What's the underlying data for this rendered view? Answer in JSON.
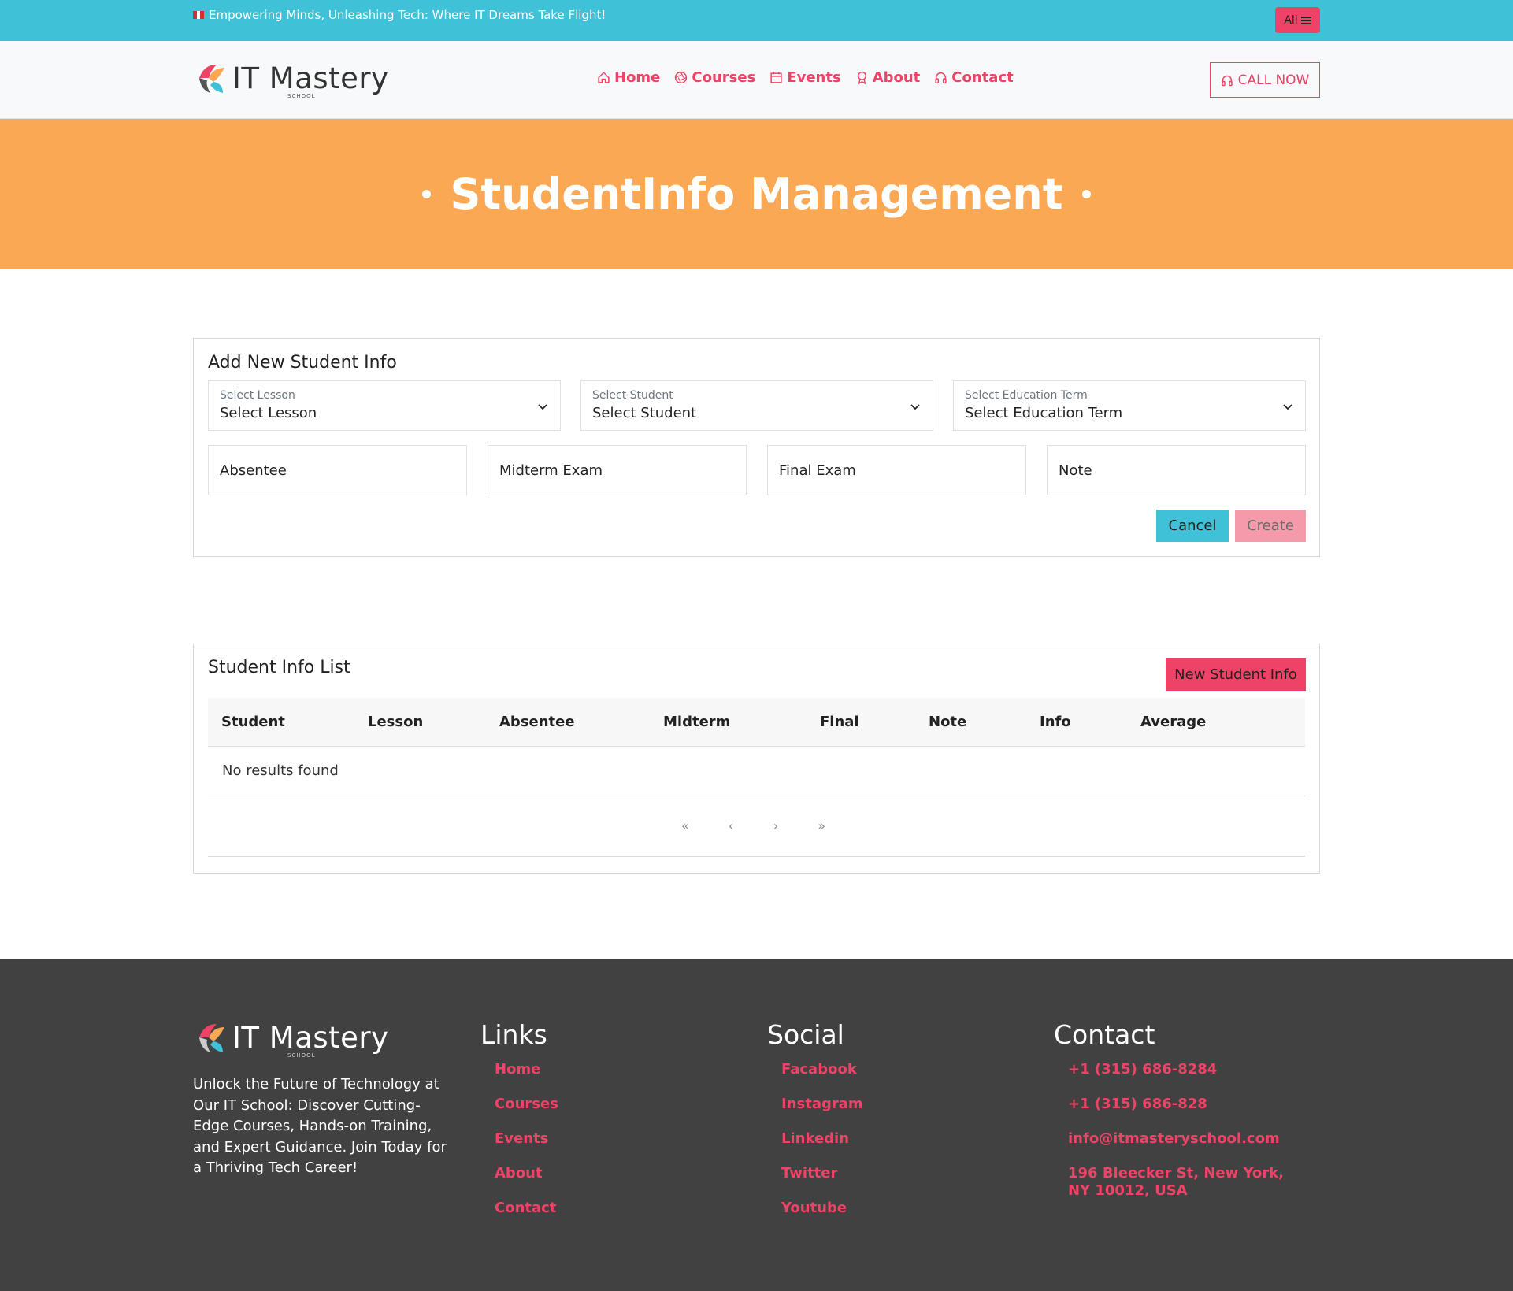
{
  "topbar": {
    "tagline": "Empowering Minds, Unleashing Tech: Where IT Dreams Take Flight!",
    "user_label": "Ali"
  },
  "brand": {
    "name": "IT Mastery",
    "sub": "SCHOOL"
  },
  "nav": {
    "items": [
      {
        "label": "Home",
        "icon": "home-icon"
      },
      {
        "label": "Courses",
        "icon": "aperture-icon"
      },
      {
        "label": "Events",
        "icon": "calendar-icon"
      },
      {
        "label": "About",
        "icon": "award-icon"
      },
      {
        "label": "Contact",
        "icon": "headphones-icon"
      }
    ],
    "call_label": "CALL NOW"
  },
  "hero": {
    "title": "StudentInfo Management"
  },
  "form": {
    "title": "Add New Student Info",
    "selects": [
      {
        "label": "Select Lesson",
        "value": "Select Lesson"
      },
      {
        "label": "Select Student",
        "value": "Select Student"
      },
      {
        "label": "Select Education Term",
        "value": "Select Education Term"
      }
    ],
    "inputs": [
      {
        "placeholder": "Absentee"
      },
      {
        "placeholder": "Midterm Exam"
      },
      {
        "placeholder": "Final Exam"
      },
      {
        "placeholder": "Note"
      }
    ],
    "cancel_label": "Cancel",
    "create_label": "Create"
  },
  "list": {
    "title": "Student Info List",
    "new_label": "New Student Info",
    "columns": [
      "Student",
      "Lesson",
      "Absentee",
      "Midterm",
      "Final",
      "Note",
      "Info",
      "Average"
    ],
    "empty_text": "No results found",
    "pager": [
      "«",
      "‹",
      "›",
      "»"
    ]
  },
  "footer": {
    "description": "Unlock the Future of Technology at Our IT School: Discover Cutting-Edge Courses, Hands-on Training, and Expert Guidance. Join Today for a Thriving Tech Career!",
    "links": {
      "title": "Links",
      "items": [
        "Home",
        "Courses",
        "Events",
        "About",
        "Contact"
      ]
    },
    "social": {
      "title": "Social",
      "items": [
        "Facabook",
        "Instagram",
        "Linkedin",
        "Twitter",
        "Youtube"
      ]
    },
    "contact": {
      "title": "Contact",
      "items": [
        "+1 (315) 686-8284",
        "+1 (315) 686-828",
        "info@itmasteryschool.com",
        "196 Bleecker St, New York, NY 10012, USA"
      ]
    }
  },
  "colors": {
    "cyan": "#3fc1d7",
    "pink": "#ee4266",
    "orange": "#faa853",
    "footer_bg": "#414142"
  }
}
